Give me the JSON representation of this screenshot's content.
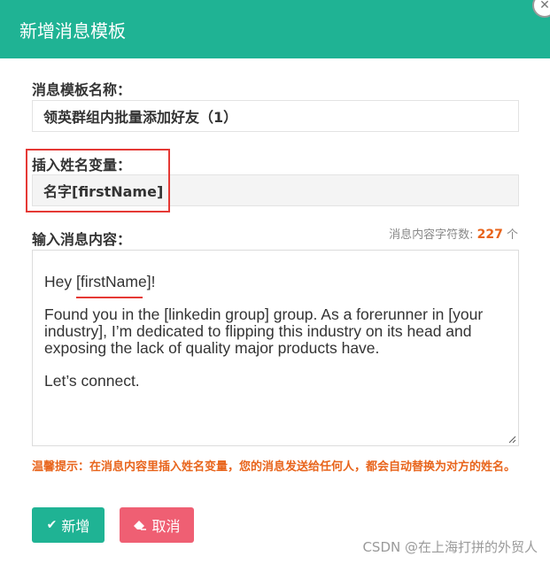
{
  "header": {
    "title": "新增消息模板",
    "close_icon": "close-icon"
  },
  "form": {
    "template_name_label": "消息模板名称：",
    "template_name_value": "领英群组内批量添加好友（1）",
    "insert_var_label": "插入姓名变量：",
    "insert_var_value": "名字[firstName]",
    "content_label": "输入消息内容：",
    "char_count_label": "消息内容字符数:",
    "char_count_value": "227",
    "char_count_unit": "个",
    "message": {
      "greeting_prefix": "Hey ",
      "greeting_var": "[firstName]",
      "greeting_suffix": "!",
      "body": "Found you in the [linkedin group] group. As a forerunner in [your industry], I’m dedicated to flipping this industry on its head and exposing the lack of quality major products have.",
      "closing": "Let’s connect."
    },
    "tip": "温馨提示：在消息内容里插入姓名变量，您的消息发送给任何人，都会自动替换为对方的姓名。"
  },
  "buttons": {
    "add_label": "新增",
    "cancel_label": "取消",
    "add_icon": "checkmark-icon",
    "cancel_icon": "eraser-icon"
  },
  "watermark": "CSDN @在上海打拼的外贸人",
  "colors": {
    "accent": "#1fb394",
    "danger": "#ef5f73",
    "highlight": "#e53935",
    "warning": "#e8641b"
  }
}
